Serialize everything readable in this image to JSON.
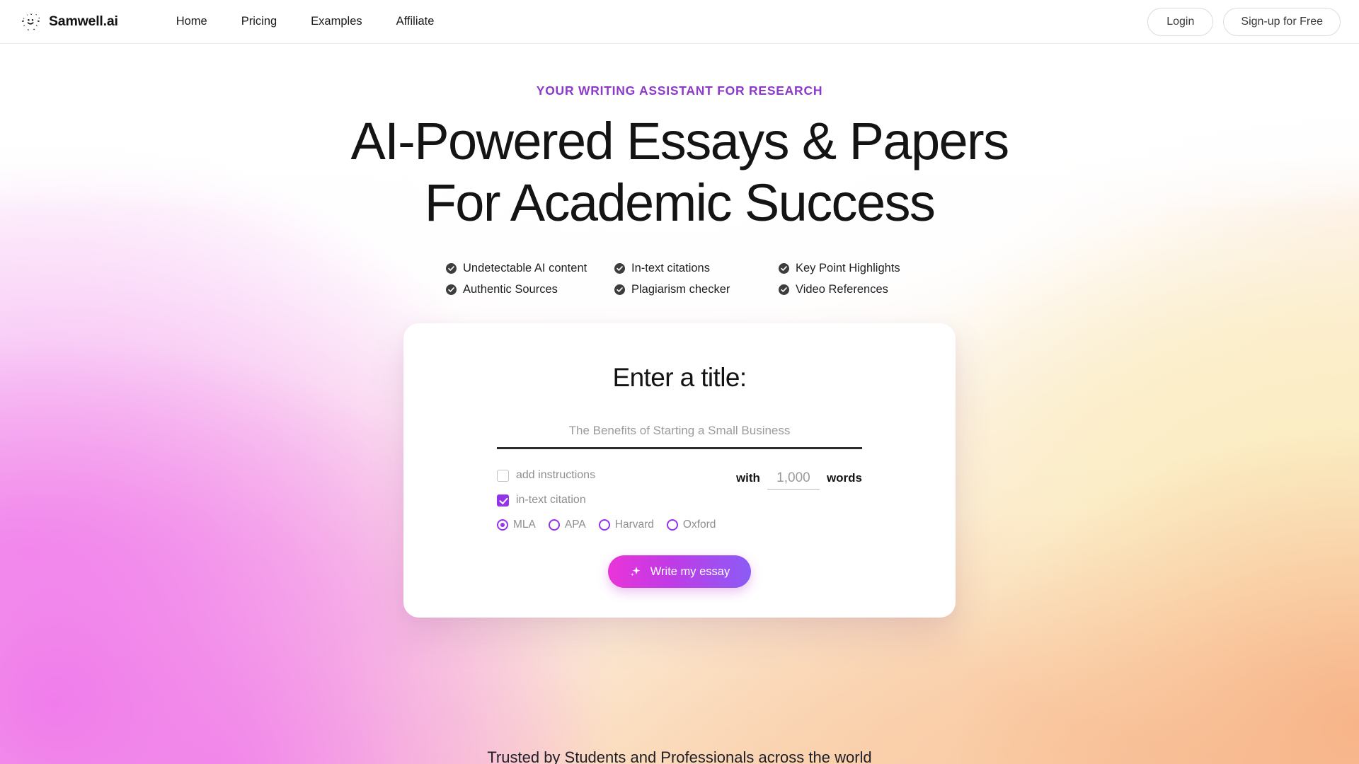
{
  "header": {
    "brand": {
      "name": "Samwell.ai",
      "logo_icon": "smiley-sparkle-logo"
    },
    "nav": [
      {
        "label": "Home"
      },
      {
        "label": "Pricing"
      },
      {
        "label": "Examples"
      },
      {
        "label": "Affiliate"
      }
    ],
    "login_label": "Login",
    "signup_label": "Sign-up for Free"
  },
  "hero": {
    "eyebrow": "YOUR WRITING ASSISTANT FOR RESEARCH",
    "headline_line1": "AI-Powered Essays & Papers",
    "headline_line2": "For Academic Success",
    "features": [
      {
        "label": "Undetectable AI content"
      },
      {
        "label": "In-text citations"
      },
      {
        "label": "Key Point Highlights"
      },
      {
        "label": "Authentic Sources"
      },
      {
        "label": "Plagiarism checker"
      },
      {
        "label": "Video References"
      }
    ]
  },
  "composer": {
    "title": "Enter a title:",
    "title_input": {
      "value": "",
      "placeholder": "The Benefits of Starting a Small Business"
    },
    "add_instructions": {
      "label": "add instructions",
      "checked": false
    },
    "in_text_citation": {
      "label": "in-text citation",
      "checked": true
    },
    "citation_styles": [
      {
        "label": "MLA",
        "selected": true
      },
      {
        "label": "APA",
        "selected": false
      },
      {
        "label": "Harvard",
        "selected": false
      },
      {
        "label": "Oxford",
        "selected": false
      }
    ],
    "wordcount": {
      "prefix": "with",
      "value": "",
      "placeholder": "1,000",
      "suffix": "words"
    },
    "submit": {
      "label": "Write my essay",
      "icon": "sparkle-icon"
    }
  },
  "footer": {
    "trusted_text": "Trusted by Students and Professionals across the world"
  },
  "colors": {
    "accent_purple": "#9333ea",
    "eyebrow_purple": "#8c39c8",
    "cta_gradient_start": "#e935d8",
    "cta_gradient_end": "#8b5cf6",
    "bg_magenta": "#f07ceb",
    "bg_yellow": "#fbeec4",
    "bg_peach": "#f8b489",
    "text_dark": "#141414",
    "text_muted": "#8f8f8f"
  }
}
